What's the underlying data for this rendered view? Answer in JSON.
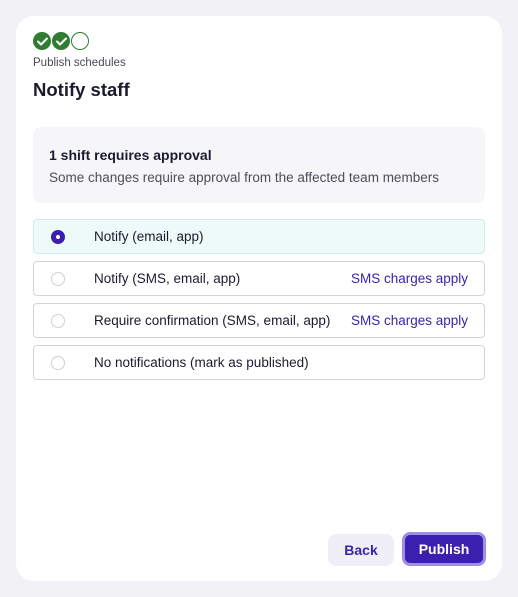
{
  "progress": {
    "steps": [
      {
        "status": "done",
        "icon": "check-icon"
      },
      {
        "status": "done",
        "icon": "check-icon"
      },
      {
        "status": "current",
        "icon": "empty-circle-icon"
      }
    ],
    "color": "#2f7d32"
  },
  "header": {
    "subtitle": "Publish schedules",
    "title": "Notify staff"
  },
  "approval": {
    "title": "1 shift requires approval",
    "text": "Some changes require approval from the affected team members"
  },
  "options": [
    {
      "label": "Notify (email, app)",
      "note": "",
      "selected": true
    },
    {
      "label": "Notify (SMS, email, app)",
      "note": "SMS charges apply",
      "selected": false
    },
    {
      "label": "Require confirmation (SMS, email, app)",
      "note": "SMS charges apply",
      "selected": false
    },
    {
      "label": "No notifications (mark as published)",
      "note": "",
      "selected": false
    }
  ],
  "footer": {
    "back_label": "Back",
    "publish_label": "Publish"
  },
  "colors": {
    "accent": "#3b1fae",
    "success": "#2f7d32",
    "selected_bg": "#eefaf8"
  }
}
